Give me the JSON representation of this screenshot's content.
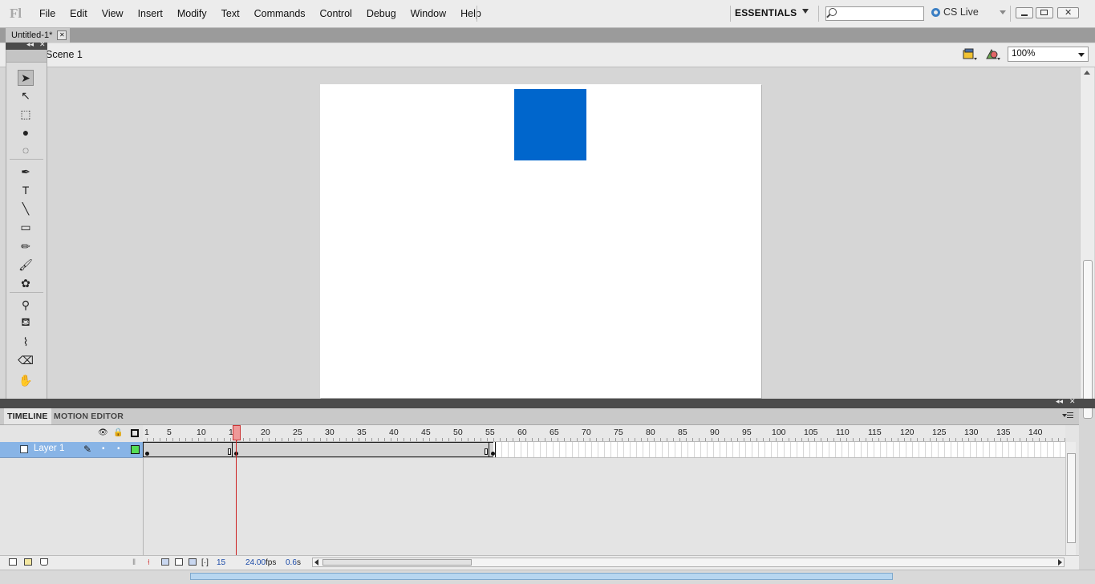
{
  "app": {
    "logo": "Fl",
    "menu": [
      "File",
      "Edit",
      "View",
      "Insert",
      "Modify",
      "Text",
      "Commands",
      "Control",
      "Debug",
      "Window",
      "Help"
    ],
    "workspace": "ESSENTIALS",
    "search_placeholder": "",
    "cs_live": "CS Live"
  },
  "document": {
    "tab_title": "Untitled-1*",
    "scene": "Scene 1",
    "zoom": "100%"
  },
  "stage": {
    "background": "#ffffff",
    "shape_color": "#0066cc"
  },
  "tools": [
    {
      "name": "selection-tool-icon",
      "glyph": "➤"
    },
    {
      "name": "subselection-tool-icon",
      "glyph": "↖"
    },
    {
      "name": "free-transform-tool-icon",
      "glyph": "⬚"
    },
    {
      "name": "3d-rotation-tool-icon",
      "glyph": "●"
    },
    {
      "name": "lasso-tool-icon",
      "glyph": "◌"
    },
    {
      "name": "pen-tool-icon",
      "glyph": "✒"
    },
    {
      "name": "text-tool-icon",
      "glyph": "T"
    },
    {
      "name": "line-tool-icon",
      "glyph": "╲"
    },
    {
      "name": "rectangle-tool-icon",
      "glyph": "▭"
    },
    {
      "name": "pencil-tool-icon",
      "glyph": "✏"
    },
    {
      "name": "brush-tool-icon",
      "glyph": "🖌"
    },
    {
      "name": "deco-tool-icon",
      "glyph": "✿"
    },
    {
      "name": "bone-tool-icon",
      "glyph": "⚲"
    },
    {
      "name": "paint-bucket-tool-icon",
      "glyph": "⛾"
    },
    {
      "name": "eyedropper-tool-icon",
      "glyph": "⌇"
    },
    {
      "name": "eraser-tool-icon",
      "glyph": "⌫"
    },
    {
      "name": "hand-tool-icon",
      "glyph": "✋"
    }
  ],
  "timeline": {
    "tabs": [
      "TIMELINE",
      "MOTION EDITOR"
    ],
    "ruler_labels": [
      "1",
      "5",
      "10",
      "15",
      "20",
      "25",
      "30",
      "35",
      "40",
      "45",
      "50",
      "55",
      "60",
      "65",
      "70",
      "75",
      "80",
      "85",
      "90",
      "95",
      "100",
      "105",
      "110",
      "115",
      "120",
      "125",
      "130",
      "135",
      "140"
    ],
    "layer_name": "Layer 1",
    "layer_color": "#55dd55",
    "current_frame": "15",
    "fps": "24.00",
    "fps_unit": "fps",
    "elapsed": "0.6",
    "elapsed_unit": "s"
  }
}
